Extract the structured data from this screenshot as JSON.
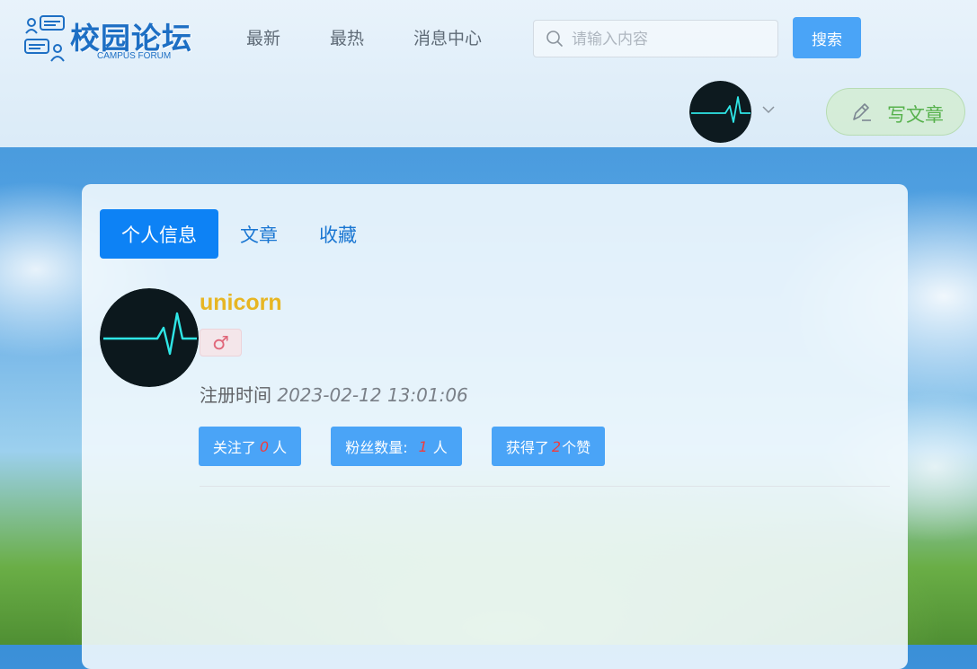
{
  "header": {
    "logo_title": "校园论坛",
    "logo_subtitle": "CAMPUS FORUM",
    "nav": [
      {
        "label": "最新"
      },
      {
        "label": "最热"
      },
      {
        "label": "消息中心"
      }
    ],
    "search": {
      "placeholder": "请输入内容",
      "value": "",
      "button_label": "搜索"
    },
    "write_label": "写文章"
  },
  "profile": {
    "tabs": [
      {
        "label": "个人信息",
        "active": true
      },
      {
        "label": "文章",
        "active": false
      },
      {
        "label": "收藏",
        "active": false
      }
    ],
    "username": "unicorn",
    "gender_symbol": "♂",
    "register_label": "注册时间",
    "register_time": "2023-02-12 13:01:06",
    "stats": {
      "following": {
        "prefix": "关注了",
        "value": "0",
        "suffix": "人"
      },
      "followers": {
        "prefix": "粉丝数量:",
        "value": "1",
        "suffix": "人"
      },
      "likes": {
        "prefix": "获得了",
        "value": "2",
        "suffix": "个赞"
      }
    }
  },
  "colors": {
    "accent": "#4aa4f7",
    "active_tab": "#0d82f5",
    "username": "#e7b623",
    "write_button": "#56b14c",
    "stat_number": "#f23b3b"
  },
  "icons": [
    "forum-logo-icon",
    "search-icon",
    "chevron-down-icon",
    "pencil-icon",
    "heartbeat-avatar-icon"
  ]
}
